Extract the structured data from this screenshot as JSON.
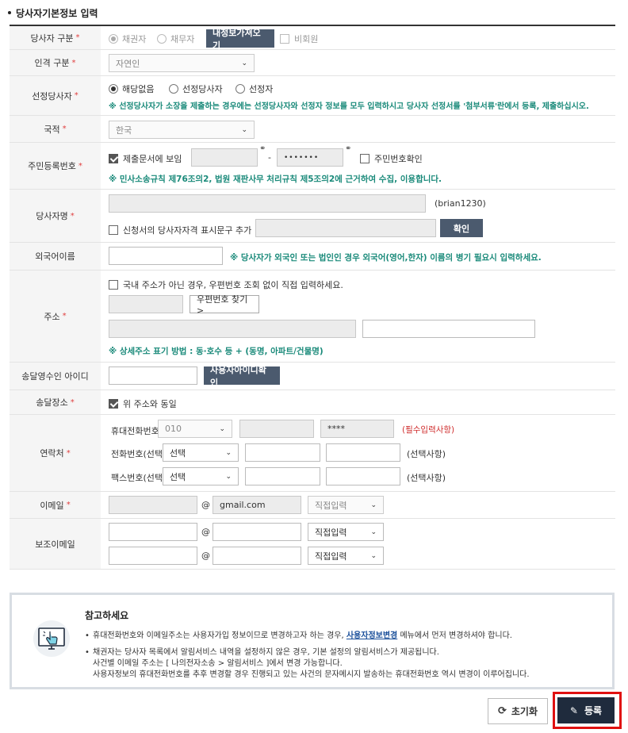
{
  "section_title": "당사자기본정보 입력",
  "required_mark": "*",
  "fields": {
    "party_type": {
      "label": "당사자 구분",
      "options": [
        "채권자",
        "채무자"
      ],
      "load_button": "내정보가져오기",
      "nonmember_label": "비회원"
    },
    "person_type": {
      "label": "인격 구분",
      "value": "자연인"
    },
    "elected_party": {
      "label": "선정당사자",
      "options": [
        "해당없음",
        "선정당사자",
        "선정자"
      ],
      "note": "※ 선정당사자가 소장을 제출하는 경우에는 선정당사자와 선정자 정보를 모두 입력하시고 당사자 선정서를 '첨부서류'란에서 등록, 제출하십시오."
    },
    "nationality": {
      "label": "국적",
      "value": "한국"
    },
    "rrn": {
      "label": "주민등록번호",
      "show_in_doc_label": "제출문서에 보임",
      "dash": "-",
      "masked_value": "•••••••",
      "confirm_label": "주민번호확인",
      "note": "※ 민사소송규칙 제76조의2, 법원 재판사무 처리규칙 제5조의2에 근거하여 수집, 이용합니다."
    },
    "party_name": {
      "label": "당사자명",
      "user_id": "(brian1230)",
      "add_phrase_label": "신청서의 당사자자격 표시문구 추가",
      "confirm_button": "확인"
    },
    "foreign_name": {
      "label": "외국어이름",
      "note": "※ 당사자가 외국인 또는 법인인 경우 외국어(영어,한자) 이름의 병기 필요시 입력하세요."
    },
    "address": {
      "label": "주소",
      "overseas_label": "국내 주소가 아닌 경우, 우편번호 조회 없이 직접 입력하세요.",
      "postcode_button": "우편번호 찾기 >",
      "note": "※ 상세주소 표기 방법 : 동·호수 등 + (동명, 아파트/건물명)"
    },
    "service_id": {
      "label": "송달영수인 아이디",
      "check_button": "사용자아이디확인"
    },
    "service_place": {
      "label": "송달장소",
      "same_label": "위 주소와 동일"
    },
    "contact": {
      "label": "연락처",
      "mobile_label": "휴대전화번호",
      "mobile_prefix": "010",
      "mobile_last": "****",
      "mobile_note": "(필수입력사항)",
      "phone_label": "전화번호(선택)",
      "phone_select": "선택",
      "phone_note": "(선택사항)",
      "fax_label": "팩스번호(선택)",
      "fax_select": "선택",
      "fax_note": "(선택사항)"
    },
    "email": {
      "label": "이메일",
      "at": "@",
      "domain": "gmail.com",
      "domain_select": "직접입력"
    },
    "sub_email": {
      "label": "보조이메일",
      "at": "@",
      "domain_select": "직접입력"
    }
  },
  "reference": {
    "title": "참고하세요",
    "line1_pre": "휴대전화번호와 이메일주소는 사용자가입 정보이므로 변경하고자 하는 경우,",
    "line1_link": "사용자정보변경",
    "line1_post": "메뉴에서 먼저 변경하셔야 합니다.",
    "line2": "채권자는 당사자 목록에서 알림서비스 내역을 설정하지 않은 경우, 기본 설정의 알림서비스가 제공됩니다.",
    "line3": "사건별 이메일 주소는 [ 나의전자소송 > 알림서비스 ]에서 변경 가능합니다.",
    "line4": "사용자정보의 휴대전화번호를 추후 변경할 경우 진행되고 있는 사건의 문자메시지 발송하는 휴대전화번호 역시 변경이 이루어집니다."
  },
  "footer": {
    "reset_label": "초기화",
    "submit_label": "등록"
  },
  "colors": {
    "dark_button": "#4b5a6e",
    "note_green": "#1a8a7a",
    "required_red": "#e04040",
    "submit_bg": "#1f2b3d",
    "highlight_red": "#e01010"
  }
}
